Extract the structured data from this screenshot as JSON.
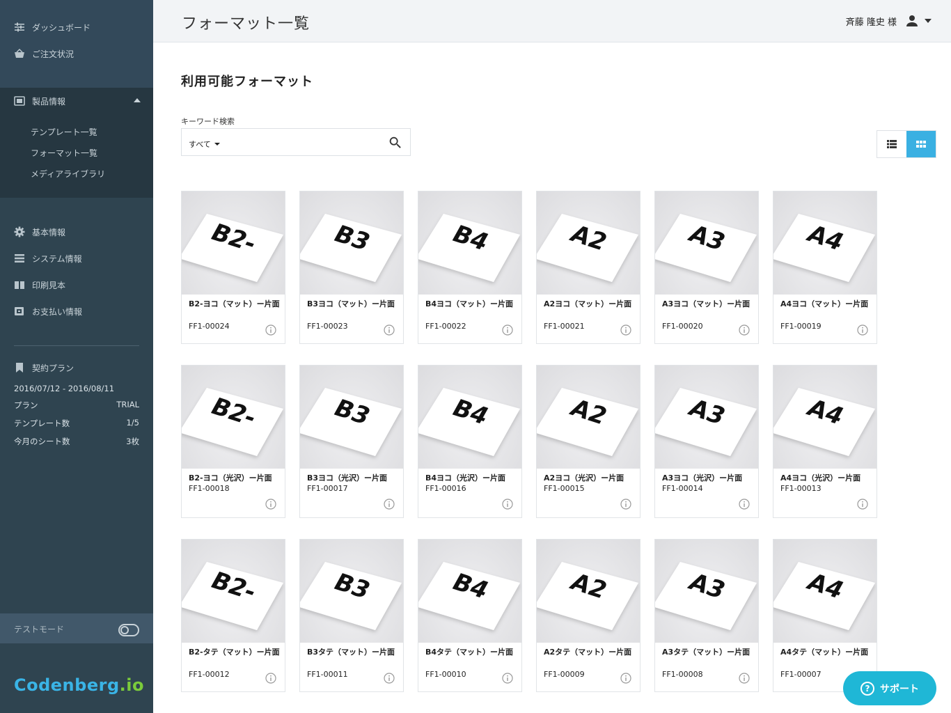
{
  "header": {
    "title": "フォーマット一覧",
    "user_name": "斉藤 隆史 様"
  },
  "sidebar": {
    "top_items": [
      {
        "label": "ダッシュボード",
        "icon": "sliders-icon"
      },
      {
        "label": "ご注文状況",
        "icon": "basket-icon"
      }
    ],
    "product": {
      "label": "製品情報",
      "icon": "product-icon"
    },
    "sub_items": [
      {
        "label": "テンプレート一覧"
      },
      {
        "label": "フォーマット一覧"
      },
      {
        "label": "メディアライブラリ"
      }
    ],
    "items": [
      {
        "label": "基本情報",
        "icon": "gear-icon"
      },
      {
        "label": "システム情報",
        "icon": "list-icon"
      },
      {
        "label": "印刷見本",
        "icon": "book-icon"
      },
      {
        "label": "お支払い情報",
        "icon": "payment-icon"
      }
    ],
    "plan": {
      "label": "契約プラン",
      "period": "2016/07/12 - 2016/08/11",
      "rows": [
        {
          "label": "プラン",
          "value": "TRIAL"
        },
        {
          "label": "テンプレート数",
          "value": "1/5"
        },
        {
          "label": "今月のシート数",
          "value": "3枚"
        }
      ]
    },
    "test_mode": "テストモード",
    "logo": {
      "main": "Codenberg",
      "suffix": ".io"
    }
  },
  "main": {
    "section_title": "利用可能フォーマット",
    "search": {
      "label": "キーワード検索",
      "select_value": "すべて"
    },
    "cards": [
      {
        "name": "B2-ヨコ（マット）ー片面",
        "code": "FF1-00024",
        "thumb": "B2-"
      },
      {
        "name": "B3ヨコ（マット）ー片面",
        "code": "FF1-00023",
        "thumb": "B3"
      },
      {
        "name": "B4ヨコ（マット）ー片面",
        "code": "FF1-00022",
        "thumb": "B4"
      },
      {
        "name": "A2ヨコ（マット）ー片面",
        "code": "FF1-00021",
        "thumb": "A2"
      },
      {
        "name": "A3ヨコ（マット）ー片面",
        "code": "FF1-00020",
        "thumb": "A3"
      },
      {
        "name": "A4ヨコ（マット）ー片面",
        "code": "FF1-00019",
        "thumb": "A4"
      },
      {
        "name": "B2-ヨコ（光沢）ー片面",
        "code": "FF1-00018",
        "thumb": "B2-"
      },
      {
        "name": "B3ヨコ（光沢）ー片面",
        "code": "FF1-00017",
        "thumb": "B3"
      },
      {
        "name": "B4ヨコ（光沢）ー片面",
        "code": "FF1-00016",
        "thumb": "B4"
      },
      {
        "name": "A2ヨコ（光沢）ー片面",
        "code": "FF1-00015",
        "thumb": "A2"
      },
      {
        "name": "A3ヨコ（光沢）ー片面",
        "code": "FF1-00014",
        "thumb": "A3"
      },
      {
        "name": "A4ヨコ（光沢）ー片面",
        "code": "FF1-00013",
        "thumb": "A4"
      },
      {
        "name": "B2-タテ（マット）ー片面",
        "code": "FF1-00012",
        "thumb": "B2-"
      },
      {
        "name": "B3タテ（マット）ー片面",
        "code": "FF1-00011",
        "thumb": "B3"
      },
      {
        "name": "B4タテ（マット）ー片面",
        "code": "FF1-00010",
        "thumb": "B4"
      },
      {
        "name": "A2タテ（マット）ー片面",
        "code": "FF1-00009",
        "thumb": "A2"
      },
      {
        "name": "A3タテ（マット）ー片面",
        "code": "FF1-00008",
        "thumb": "A3"
      },
      {
        "name": "A4タテ（マット）ー片面",
        "code": "FF1-00007",
        "thumb": "A4"
      }
    ]
  },
  "support": {
    "label": "サポート"
  },
  "colors": {
    "sidebar": "#2f4450",
    "accent": "#3ab0e2",
    "support": "#1fb7d6"
  }
}
